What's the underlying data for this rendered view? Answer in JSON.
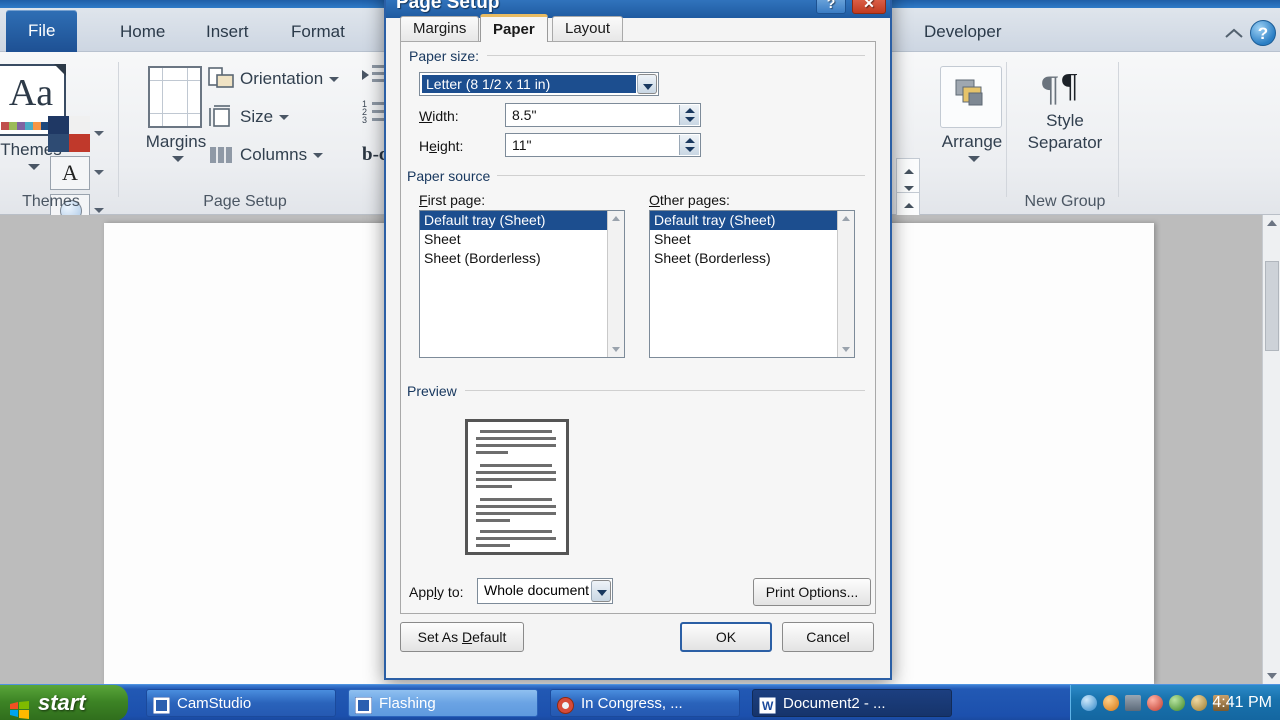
{
  "app": {
    "ribbon_tabs": [
      {
        "label": "File",
        "type": "file"
      },
      {
        "label": "Home",
        "type": "normal"
      },
      {
        "label": "Insert",
        "type": "normal"
      },
      {
        "label": "Format",
        "type": "normal"
      },
      {
        "label": "Developer",
        "type": "normal"
      }
    ],
    "help_icon": "?",
    "groups": {
      "themes": {
        "title": "Themes",
        "big_button_label": "Themes",
        "big_button_glyph": "Aa",
        "theme_colors_icon": "theme-colors-icon",
        "theme_fonts_glyph": "A",
        "theme_effects_icon": "theme-effects-icon"
      },
      "page_setup": {
        "title": "Page Setup",
        "margins_label": "Margins",
        "items": [
          {
            "label": "Orientation",
            "icon": "orientation-icon"
          },
          {
            "label": "Size",
            "icon": "size-icon"
          },
          {
            "label": "Columns",
            "icon": "columns-icon"
          }
        ]
      },
      "arrange": {
        "title": "",
        "label": "Arrange"
      },
      "new_group": {
        "title": "New Group",
        "label": "Style Separator"
      }
    }
  },
  "dialog": {
    "title": "Page Setup",
    "help_button": "?",
    "close_button": "✕",
    "tabs": [
      {
        "label": "Margins",
        "active": false
      },
      {
        "label": "Paper",
        "active": true
      },
      {
        "label": "Layout",
        "active": false
      }
    ],
    "paper_size": {
      "legend": "Paper size:",
      "selected": "Letter (8 1/2 x 11 in)",
      "width_label": "Width:",
      "width_value": "8.5\"",
      "height_label": "Height:",
      "height_value": "11\""
    },
    "paper_source": {
      "legend": "Paper source",
      "first_page_label": "First page:",
      "other_pages_label": "Other pages:",
      "first_page_items": [
        "Default tray (Sheet)",
        "Sheet",
        "Sheet (Borderless)"
      ],
      "first_page_selected_index": 0,
      "other_pages_items": [
        "Default tray (Sheet)",
        "Sheet",
        "Sheet (Borderless)"
      ],
      "other_pages_selected_index": 0
    },
    "preview": {
      "legend": "Preview",
      "apply_to_label": "Apply to:",
      "apply_to_value": "Whole document",
      "print_options_label": "Print Options..."
    },
    "footer": {
      "set_as_default": "Set As Default",
      "ok": "OK",
      "cancel": "Cancel"
    },
    "accent_color": "#2b5fa5",
    "selection_color": "#1c4e8f",
    "tab_highlight_color": "#e8bb62"
  },
  "taskbar": {
    "start_label": "start",
    "buttons": [
      {
        "label": "CamStudio",
        "state": "normal"
      },
      {
        "label": "Flashing",
        "state": "active"
      },
      {
        "label": "In Congress, ...",
        "state": "normal"
      },
      {
        "label": "Document2 - ...",
        "state": "dark"
      }
    ],
    "clock": "4:41 PM"
  }
}
